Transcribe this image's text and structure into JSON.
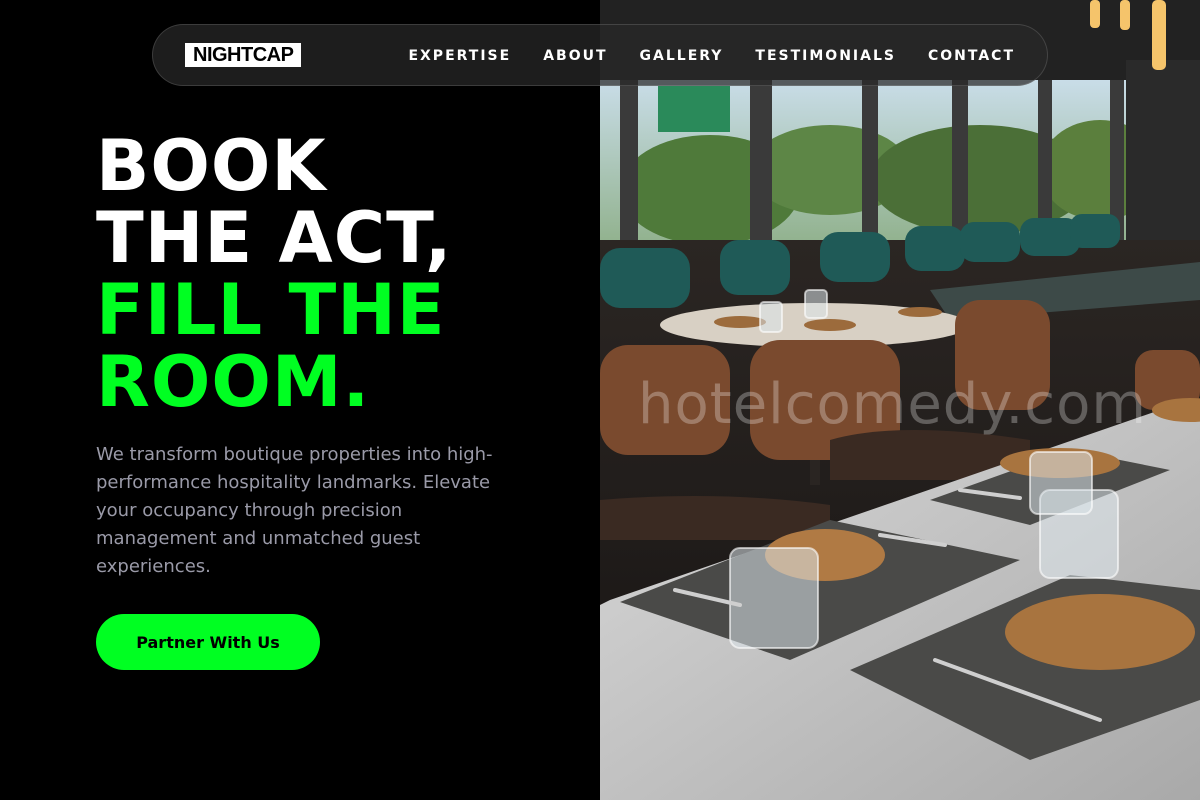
{
  "brand": {
    "logo_text": "NIGHTCAP"
  },
  "nav": {
    "items": [
      {
        "label": "EXPERTISE"
      },
      {
        "label": "ABOUT"
      },
      {
        "label": "GALLERY"
      },
      {
        "label": "TESTIMONIALS"
      },
      {
        "label": "CONTACT"
      }
    ]
  },
  "hero": {
    "headline_white": [
      "BOOK",
      "THE ACT,"
    ],
    "headline_green": [
      "FILL THE",
      "ROOM."
    ],
    "description": "We transform boutique properties into high-performance hospitality landmarks. Elevate your occupancy through precision management and unmatched guest experiences.",
    "cta_label": "Partner With Us",
    "image_watermark": "hotelcomedy.com"
  },
  "colors": {
    "background": "#000000",
    "accent_green": "#00ff22",
    "text_white": "#ffffff",
    "text_muted": "#9a9aa8"
  }
}
